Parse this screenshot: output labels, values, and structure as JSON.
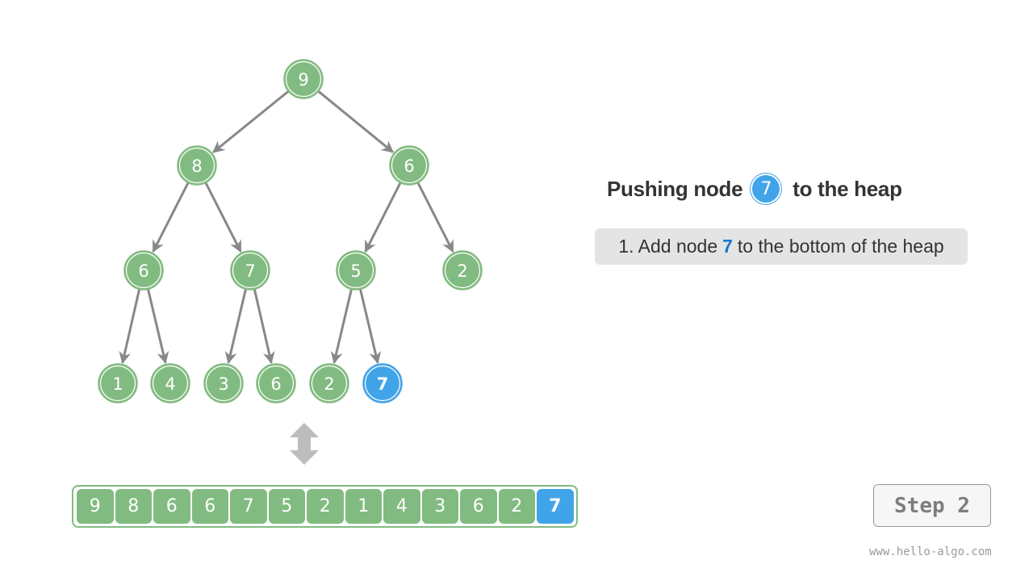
{
  "colors": {
    "node": "#82bb81",
    "highlight": "#42a4e8",
    "edge": "#888888",
    "accent_text": "#1976d2"
  },
  "tree": {
    "nodes": [
      {
        "id": 0,
        "value": "9",
        "highlight": false
      },
      {
        "id": 1,
        "value": "8",
        "highlight": false
      },
      {
        "id": 2,
        "value": "6",
        "highlight": false
      },
      {
        "id": 3,
        "value": "6",
        "highlight": false
      },
      {
        "id": 4,
        "value": "7",
        "highlight": false
      },
      {
        "id": 5,
        "value": "5",
        "highlight": false
      },
      {
        "id": 6,
        "value": "2",
        "highlight": false
      },
      {
        "id": 7,
        "value": "1",
        "highlight": false
      },
      {
        "id": 8,
        "value": "4",
        "highlight": false
      },
      {
        "id": 9,
        "value": "3",
        "highlight": false
      },
      {
        "id": 10,
        "value": "6",
        "highlight": false
      },
      {
        "id": 11,
        "value": "2",
        "highlight": false
      },
      {
        "id": 12,
        "value": "7",
        "highlight": true
      }
    ],
    "edges": [
      [
        0,
        1
      ],
      [
        0,
        2
      ],
      [
        1,
        3
      ],
      [
        1,
        4
      ],
      [
        2,
        5
      ],
      [
        2,
        6
      ],
      [
        3,
        7
      ],
      [
        3,
        8
      ],
      [
        4,
        9
      ],
      [
        4,
        10
      ],
      [
        5,
        11
      ],
      [
        5,
        12
      ]
    ]
  },
  "array": {
    "values": [
      "9",
      "8",
      "6",
      "6",
      "7",
      "5",
      "2",
      "1",
      "4",
      "3",
      "6",
      "2",
      "7"
    ],
    "highlight_index": 12
  },
  "title": {
    "prefix": "Pushing node",
    "node_value": "7",
    "suffix": "to the heap"
  },
  "step_description": {
    "prefix": "1. Add node",
    "value": "7",
    "suffix": "to the bottom of the heap"
  },
  "step_button": {
    "label": "Step 2"
  },
  "watermark": "www.hello-algo.com",
  "icons": {
    "swap": "double-arrow-up-down-icon"
  }
}
